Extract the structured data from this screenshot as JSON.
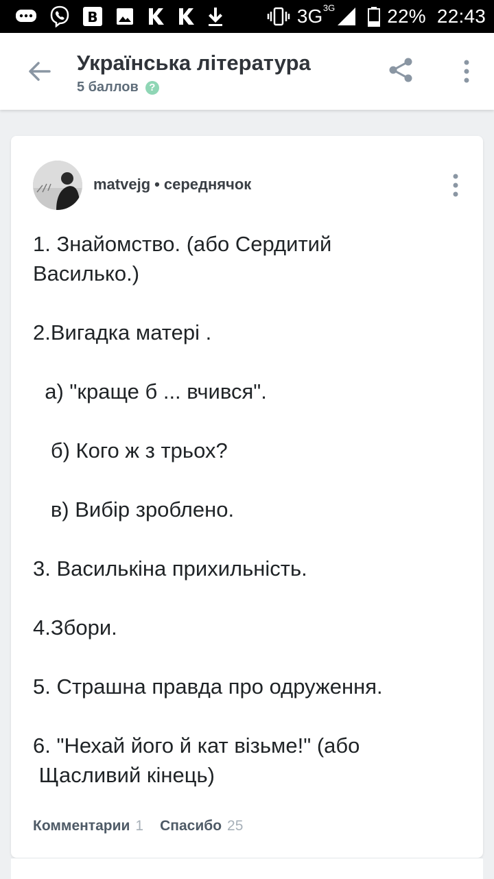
{
  "status_bar": {
    "icons": [
      "message-icon",
      "viber-icon",
      "b-app-icon",
      "image-icon",
      "k-app-icon",
      "k-app-icon",
      "download-icon",
      "vibrate-icon",
      "signal-icon",
      "battery-icon"
    ],
    "network": "3G",
    "network_sup": "3G",
    "battery": "22%",
    "time": "22:43"
  },
  "header": {
    "title": "Українська література",
    "points": "5 баллов",
    "help": "?"
  },
  "answer": {
    "username": "matvejg",
    "rank": "середнячок",
    "lines": [
      "1. Знайомство. (або Сердитий",
      "Василько.)",
      "",
      "2.Вигадка матері .",
      "",
      "  а) \"краще б ... вчився\".",
      "",
      "   б) Кого ж з трьох?",
      "",
      "   в) Вибір зроблено.",
      "",
      "3. Василькіна прихильність.",
      "",
      "4.Збори.",
      "",
      "5. Страшна правда про одруження.",
      "",
      "6. \"Нехай його й кат візьме!\" (або",
      " Щасливий кінець)"
    ],
    "comments_label": "Комментарии",
    "comments_count": "1",
    "thanks_label": "Спасибо",
    "thanks_count": "25"
  },
  "colors": {
    "accent_green": "#8fd6b5",
    "text_dark": "#1f2326",
    "muted": "#a7b0b8"
  }
}
